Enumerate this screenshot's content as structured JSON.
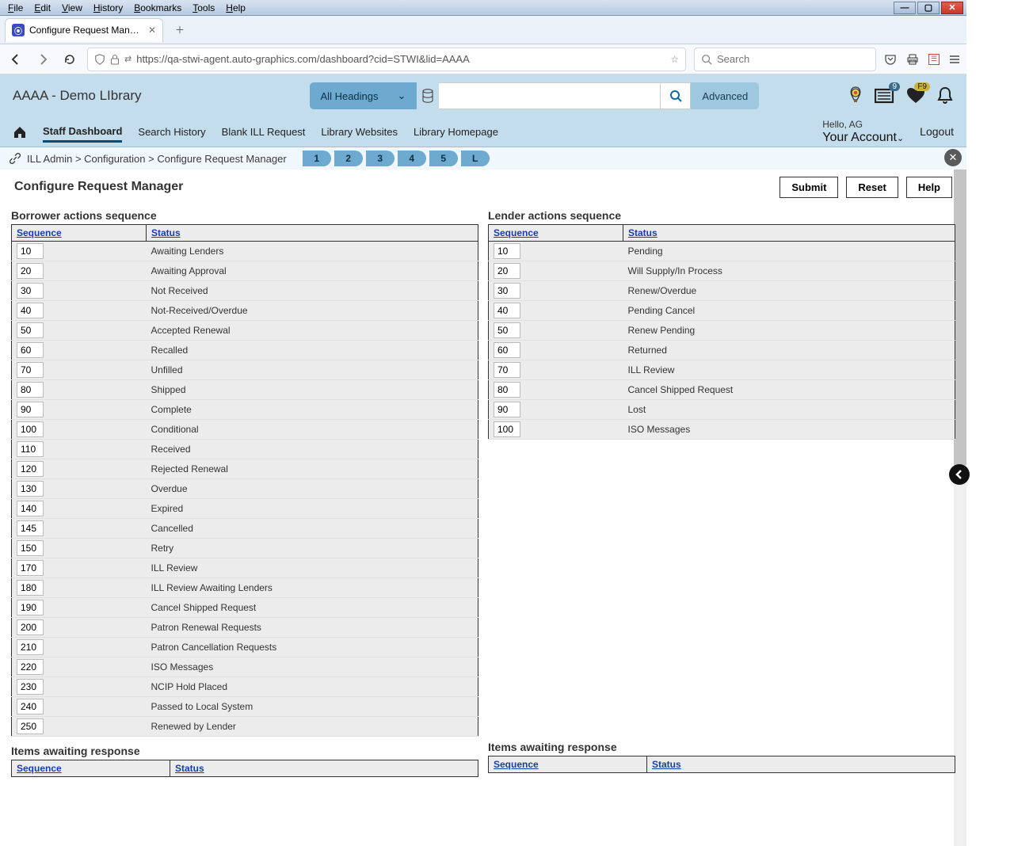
{
  "window": {
    "menus": [
      "File",
      "Edit",
      "View",
      "History",
      "Bookmarks",
      "Tools",
      "Help"
    ]
  },
  "tab": {
    "title": "Configure Request Manager | ST"
  },
  "url": "https://qa-stwi-agent.auto-graphics.com/dashboard?cid=STWI&lid=AAAA",
  "search_placeholder": "Search",
  "library_name": "AAAA - Demo LIbrary",
  "headings_label": "All Headings",
  "advanced_label": "Advanced",
  "nav": {
    "items": [
      "Staff Dashboard",
      "Search History",
      "Blank ILL Request",
      "Library Websites",
      "Library Homepage"
    ]
  },
  "hello_text": "Hello, AG",
  "account_label": "Your Account",
  "logout_label": "Logout",
  "breadcrumb": [
    "ILL Admin",
    "Configuration",
    "Configure Request Manager"
  ],
  "steps": [
    "1",
    "2",
    "3",
    "4",
    "5",
    "L"
  ],
  "page_title": "Configure Request Manager",
  "buttons": {
    "submit": "Submit",
    "reset": "Reset",
    "help": "Help"
  },
  "headers": {
    "sequence": "Sequence",
    "status": "Status"
  },
  "notif_count": "9",
  "fav_badge": "F9",
  "sections": {
    "borrower_title": "Borrower actions sequence",
    "lender_title": "Lender actions sequence",
    "items_awaiting": "Items awaiting response"
  },
  "borrower": [
    {
      "seq": "10",
      "status": "Awaiting Lenders"
    },
    {
      "seq": "20",
      "status": "Awaiting Approval"
    },
    {
      "seq": "30",
      "status": "Not Received"
    },
    {
      "seq": "40",
      "status": "Not-Received/Overdue"
    },
    {
      "seq": "50",
      "status": "Accepted Renewal"
    },
    {
      "seq": "60",
      "status": "Recalled"
    },
    {
      "seq": "70",
      "status": "Unfilled"
    },
    {
      "seq": "80",
      "status": "Shipped"
    },
    {
      "seq": "90",
      "status": "Complete"
    },
    {
      "seq": "100",
      "status": "Conditional"
    },
    {
      "seq": "110",
      "status": "Received"
    },
    {
      "seq": "120",
      "status": "Rejected Renewal"
    },
    {
      "seq": "130",
      "status": "Overdue"
    },
    {
      "seq": "140",
      "status": "Expired"
    },
    {
      "seq": "145",
      "status": "Cancelled"
    },
    {
      "seq": "150",
      "status": "Retry"
    },
    {
      "seq": "170",
      "status": "ILL Review"
    },
    {
      "seq": "180",
      "status": "ILL Review Awaiting Lenders"
    },
    {
      "seq": "190",
      "status": "Cancel Shipped Request"
    },
    {
      "seq": "200",
      "status": "Patron Renewal Requests"
    },
    {
      "seq": "210",
      "status": "Patron Cancellation Requests"
    },
    {
      "seq": "220",
      "status": "ISO Messages"
    },
    {
      "seq": "230",
      "status": "NCIP Hold Placed"
    },
    {
      "seq": "240",
      "status": "Passed to Local System"
    },
    {
      "seq": "250",
      "status": "Renewed by Lender"
    }
  ],
  "lender": [
    {
      "seq": "10",
      "status": "Pending"
    },
    {
      "seq": "20",
      "status": "Will Supply/In Process"
    },
    {
      "seq": "30",
      "status": "Renew/Overdue"
    },
    {
      "seq": "40",
      "status": "Pending Cancel"
    },
    {
      "seq": "50",
      "status": "Renew Pending"
    },
    {
      "seq": "60",
      "status": "Returned"
    },
    {
      "seq": "70",
      "status": "ILL Review"
    },
    {
      "seq": "80",
      "status": "Cancel Shipped Request"
    },
    {
      "seq": "90",
      "status": "Lost"
    },
    {
      "seq": "100",
      "status": "ISO Messages"
    }
  ]
}
